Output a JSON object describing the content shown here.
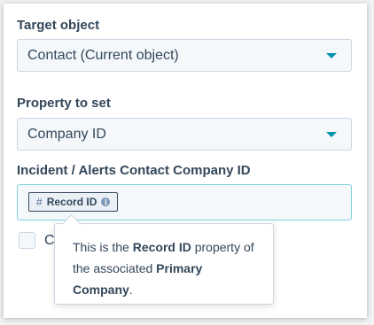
{
  "target_object": {
    "label": "Target object",
    "value": "Contact (Current object)"
  },
  "property_to_set": {
    "label": "Property to set",
    "value": "Company ID"
  },
  "field": {
    "label": "Incident / Alerts Contact Company ID",
    "token_prefix": "#",
    "token_label": "Record ID",
    "token_info": "i"
  },
  "checkbox": {
    "label": "C",
    "checked": false
  },
  "tooltip": {
    "part1": "This is the ",
    "bold1": "Record ID",
    "part2": " property of the associated ",
    "bold2": "Primary Company",
    "part3": "."
  },
  "colors": {
    "accent": "#0091ae",
    "text": "#33475b",
    "field_bg": "#f5f8fa",
    "border": "#cbd6e2"
  }
}
